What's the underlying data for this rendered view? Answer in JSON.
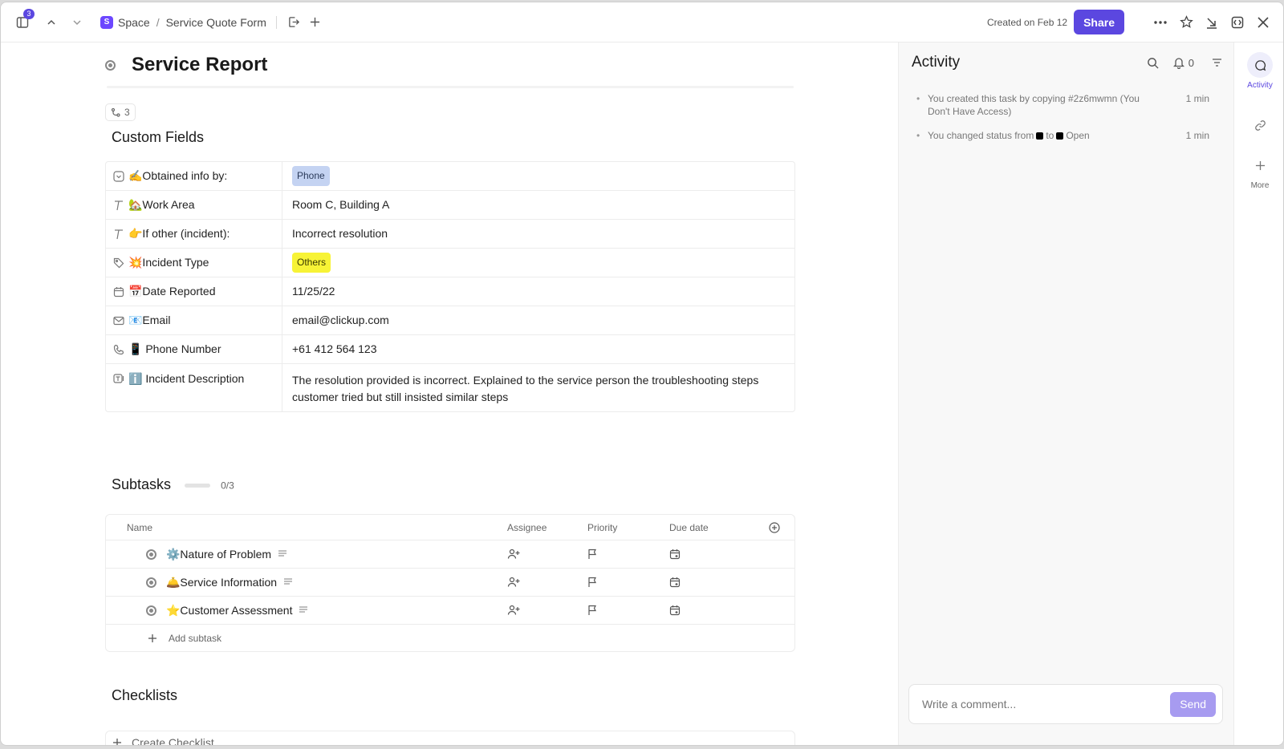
{
  "topbar": {
    "notification_count": "3",
    "breadcrumb": {
      "space": "Space",
      "separator": "/",
      "list": "Service Quote Form"
    },
    "created": "Created on Feb 12",
    "share_label": "Share"
  },
  "task": {
    "title": "Service Report",
    "relationship_count": "3"
  },
  "custom_fields": {
    "heading": "Custom Fields",
    "rows": [
      {
        "icon": "dropdown-icon",
        "label": "✍️Obtained info by:",
        "value": "Phone"
      },
      {
        "icon": "text-icon",
        "label": "🏡Work Area",
        "value": "Room C, Building A"
      },
      {
        "icon": "text-icon",
        "label": "👉If other (incident):",
        "value": "Incorrect resolution"
      },
      {
        "icon": "tag-icon",
        "label": "💥Incident Type",
        "value": "Others"
      },
      {
        "icon": "calendar-icon",
        "label": "📅Date Reported",
        "value": "11/25/22"
      },
      {
        "icon": "email-icon",
        "label": "📧Email",
        "value": "email@clickup.com"
      },
      {
        "icon": "phone-icon",
        "label": "📱 Phone Number",
        "value": "+61 412 564 123"
      },
      {
        "icon": "long-text-icon",
        "label": "ℹ️ Incident Description",
        "value": "The resolution provided is incorrect. Explained to the service person the troubleshooting steps customer tried but still insisted similar steps"
      }
    ]
  },
  "subtasks": {
    "heading": "Subtasks",
    "progress_text": "0/3",
    "progress": 0,
    "columns": {
      "name": "Name",
      "assignee": "Assignee",
      "priority": "Priority",
      "due": "Due date"
    },
    "rows": [
      {
        "name": "⚙️Nature of Problem"
      },
      {
        "name": "🛎️Service Information"
      },
      {
        "name": "⭐Customer Assessment"
      }
    ],
    "add_label": "Add subtask"
  },
  "checklists": {
    "heading": "Checklists",
    "create_label": "Create Checklist"
  },
  "activity": {
    "title": "Activity",
    "notification_count": "0",
    "items": [
      {
        "text": "You created this task by copying #2z6mwmn (You Don't Have Access)",
        "time": "1 min"
      },
      {
        "text_before": "You changed status from",
        "text_mid": "to",
        "text_after": "Open",
        "time": "1 min"
      }
    ],
    "comment_placeholder": "Write a comment...",
    "send_label": "Send"
  },
  "rail": {
    "activity_label": "Activity",
    "more_label": "More"
  },
  "colors": {
    "accent": "#5b47e0",
    "tag_phone": "#c4d3f2",
    "tag_others": "#f7f336"
  }
}
